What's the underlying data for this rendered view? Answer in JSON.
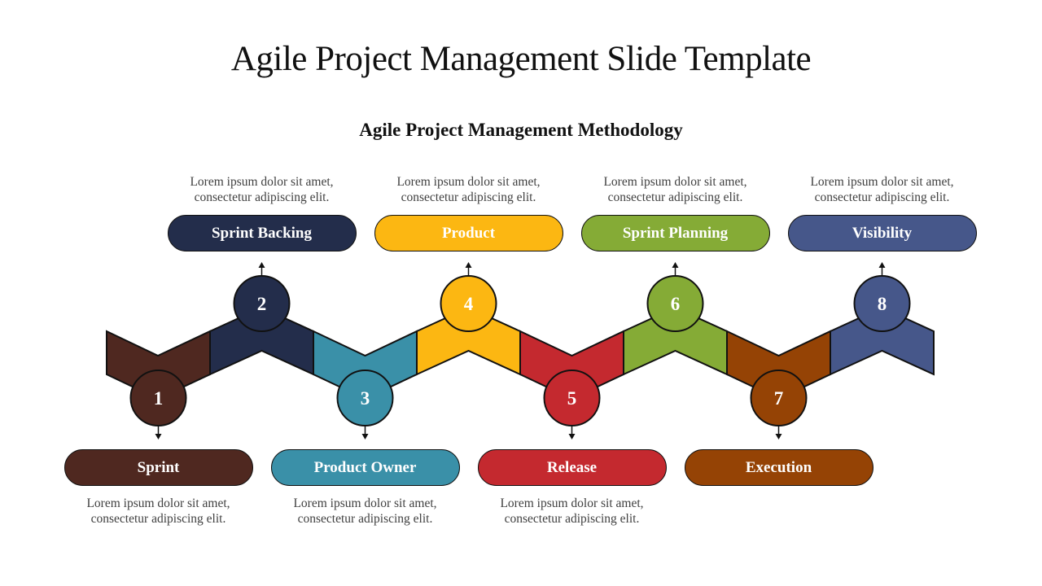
{
  "title": "Agile Project Management Slide Template",
  "subtitle": "Agile Project Management Methodology",
  "steps": [
    {
      "number": "1",
      "label": "Sprint",
      "color": "#4F2820",
      "position": "bottom",
      "desc_line1": "Lorem ipsum dolor sit amet,",
      "desc_line2": "consectetur adipiscing elit."
    },
    {
      "number": "2",
      "label": "Sprint Backing",
      "color": "#232D4B",
      "position": "top",
      "desc_line1": "Lorem ipsum dolor sit amet,",
      "desc_line2": "consectetur adipiscing elit."
    },
    {
      "number": "3",
      "label": "Product Owner",
      "color": "#3A90A8",
      "position": "bottom",
      "desc_line1": "Lorem ipsum dolor sit amet,",
      "desc_line2": "consectetur adipiscing elit."
    },
    {
      "number": "4",
      "label": "Product",
      "color": "#FCB712",
      "position": "top",
      "desc_line1": "Lorem ipsum dolor sit amet,",
      "desc_line2": "consectetur adipiscing elit."
    },
    {
      "number": "5",
      "label": "Release",
      "color": "#C4292F",
      "position": "bottom",
      "desc_line1": "Lorem ipsum dolor sit amet,",
      "desc_line2": "consectetur adipiscing elit."
    },
    {
      "number": "6",
      "label": "Sprint Planning",
      "color": "#85AB36",
      "position": "top",
      "desc_line1": "Lorem ipsum dolor sit amet,",
      "desc_line2": "consectetur adipiscing elit."
    },
    {
      "number": "7",
      "label": "Execution",
      "color": "#954305",
      "position": "bottom",
      "desc_line1": "",
      "desc_line2": ""
    },
    {
      "number": "8",
      "label": "Visibility",
      "color": "#46578A",
      "position": "top",
      "desc_line1": "Lorem ipsum dolor sit amet,",
      "desc_line2": "consectetur adipiscing elit."
    }
  ]
}
